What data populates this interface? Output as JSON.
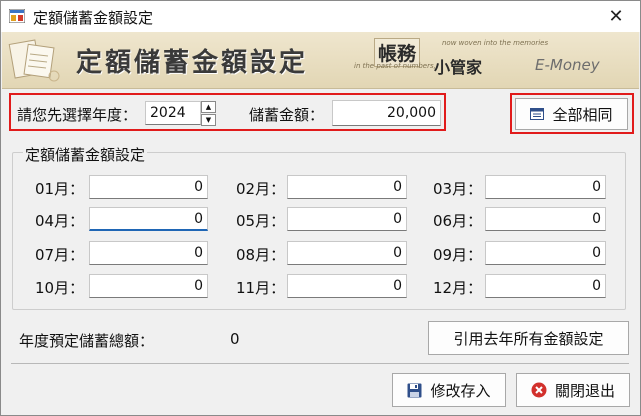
{
  "window": {
    "title": "定額儲蓄金額設定",
    "close_glyph": "✕"
  },
  "banner": {
    "title": "定額儲蓄金額設定",
    "logo_main": "帳務",
    "logo_tagline1": "now woven into the memories",
    "logo_tagline2": "in the past of numbers,",
    "logo_sub": "小管家",
    "logo_brand": "E-Money"
  },
  "year_selector": {
    "label": "請您先選擇年度：",
    "value": "2024"
  },
  "amount": {
    "label": "儲蓄金額：",
    "value": "20,000"
  },
  "apply_all_button": {
    "label": "全部相同",
    "icon": "table-icon"
  },
  "group": {
    "title": "定額儲蓄金額設定",
    "months": [
      {
        "label": "01月：",
        "value": "0"
      },
      {
        "label": "02月：",
        "value": "0"
      },
      {
        "label": "03月：",
        "value": "0"
      },
      {
        "label": "04月：",
        "value": "0"
      },
      {
        "label": "05月：",
        "value": "0"
      },
      {
        "label": "06月：",
        "value": "0"
      },
      {
        "label": "07月：",
        "value": "0"
      },
      {
        "label": "08月：",
        "value": "0"
      },
      {
        "label": "09月：",
        "value": "0"
      },
      {
        "label": "10月：",
        "value": "0"
      },
      {
        "label": "11月：",
        "value": "0"
      },
      {
        "label": "12月：",
        "value": "0"
      }
    ]
  },
  "total": {
    "label": "年度預定儲蓄總額：",
    "value": "0"
  },
  "copy_last_year_button": {
    "label": "引用去年所有金額設定"
  },
  "save_button": {
    "label": "修改存入",
    "icon": "floppy-disk-icon"
  },
  "exit_button": {
    "label": "關閉退出",
    "icon": "close-circle-icon"
  },
  "colors": {
    "highlight_border": "#e11b1b",
    "focus_underline": "#1f66b5",
    "exit_icon": "#d2302c",
    "save_icon": "#2f4f8a"
  }
}
